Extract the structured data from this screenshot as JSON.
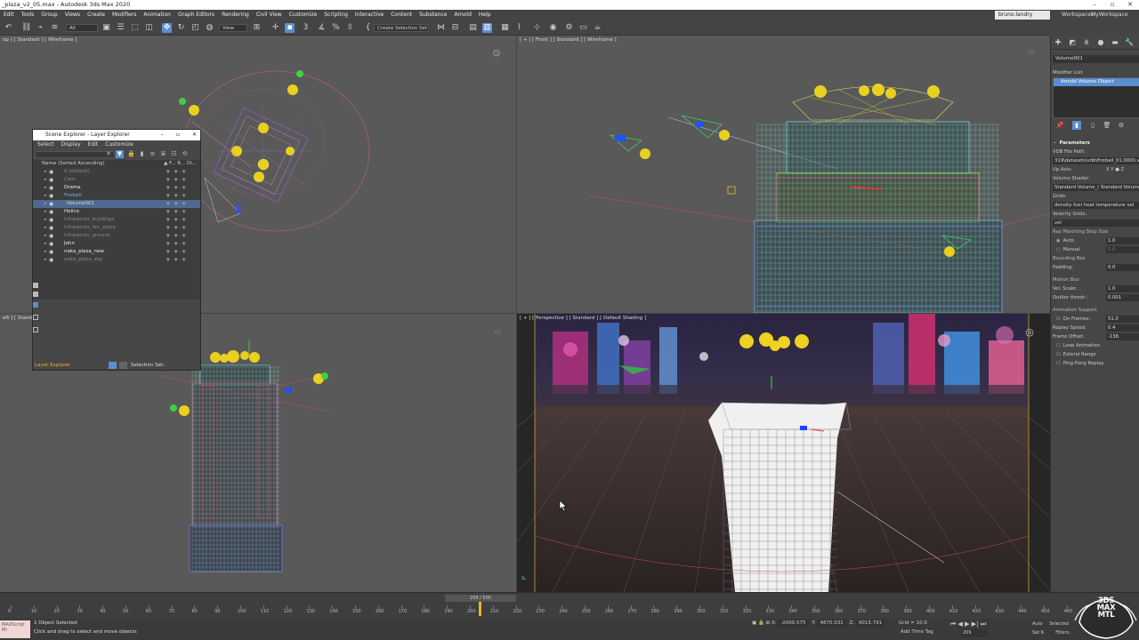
{
  "app": {
    "title": "_plaza_v2_05.max - Autodesk 3ds Max 2020"
  },
  "menubar": {
    "items": [
      "Edit",
      "Tools",
      "Group",
      "Views",
      "Create",
      "Modifiers",
      "Animation",
      "Graph Editors",
      "Rendering",
      "Civil View",
      "Customize",
      "Scripting",
      "Interactive",
      "Content",
      "Substance",
      "Arnold",
      "Help"
    ],
    "user": "bruno.landry",
    "workspaces_label": "Workspaces:",
    "workspace_value": "MyWorkspace"
  },
  "toolbar": {
    "filter_value": "All",
    "view_value": "View",
    "selection_set_placeholder": "Create Selection Set"
  },
  "viewports": {
    "top_left_label": "op ] [ Standard ] [ Wireframe ]",
    "top_right_label": "[ + ] [ Front ] [ Standard ] [ Wireframe ]",
    "bottom_left_label": "eft ] [ Standa",
    "bottom_right_label": "[ + ] [ Perspective ] [ Standard ] [ Default Shading ]"
  },
  "scene_explorer": {
    "title": "Scene Explorer - Layer Explorer",
    "menu": [
      "Select",
      "Display",
      "Edit",
      "Customize"
    ],
    "header": "Name (Sorted Ascending)",
    "header_cols": "▲ F...  R...  Di...",
    "rows": [
      {
        "name": "0 (default)",
        "style": "dim",
        "indent": 70
      },
      {
        "name": "Cam",
        "style": "dim",
        "indent": 70
      },
      {
        "name": "Drama",
        "style": "bright",
        "indent": 70
      },
      {
        "name": "Fireball",
        "style": "hl",
        "indent": 70
      },
      {
        "name": "Volume001",
        "style": "sel",
        "indent": 76
      },
      {
        "name": "Helico",
        "style": "bright",
        "indent": 70
      },
      {
        "name": "infraworks_buildings",
        "style": "dim",
        "indent": 70
      },
      {
        "name": "infraworks_fen_plaza",
        "style": "dim",
        "indent": 70
      },
      {
        "name": "infraworks_ground",
        "style": "dim",
        "indent": 70
      },
      {
        "name": "John",
        "style": "bright",
        "indent": 70
      },
      {
        "name": "naka_plaza_new",
        "style": "bright",
        "indent": 70
      },
      {
        "name": "naka_plaza_skp",
        "style": "dim",
        "indent": 70
      }
    ],
    "footer_label": "Layer Explorer",
    "selection_set_label": "Selection Set:"
  },
  "command_panel": {
    "object_name": "Volume001",
    "modifier_list_label": "Modifier List",
    "stack_item": "Arnold Volume Object",
    "params": {
      "title": "Parameters",
      "vdb_label": "VDB File Path:",
      "vdb_value": "319\\datasets\\vdb\\fireball_01.0000.vdb",
      "up_axis_label": "Up Axis:",
      "up_axis_value": "X  Y  ● Z",
      "shader_label": "Volume Shader:",
      "shader_value": "Standard Volume_( Standard Volume )",
      "grids_label": "Grids:",
      "grids_value": "density fuel heat temperature vel",
      "velocity_label": "Velocity Grids:",
      "velocity_value": "vel",
      "ray_label": "Ray Marching Step Size",
      "auto_label": "Auto",
      "auto_value": "1.0",
      "manual_label": "Manual",
      "manual_value": "1.0",
      "bbox_label": "Bounding Box",
      "padding_label": "Padding:",
      "padding_value": "0.0",
      "blur_label": "Motion Blur",
      "vel_scale_label": "Vel. Scale:",
      "vel_scale_value": "1.0",
      "outlier_label": "Outlier thresh.:",
      "outlier_value": "0.001",
      "anim_label": "Animation Support",
      "on_frames_label": "On Frames:",
      "on_frames_value": "51.0",
      "replay_label": "Replay Speed:",
      "replay_value": "0.4",
      "offset_label": "Frame Offset:",
      "offset_value": "-138",
      "loop_label": "Loop Animation",
      "extend_label": "Extend Range",
      "pingpong_label": "Ping-Pong Replay"
    }
  },
  "timeline": {
    "frame_display": "209 / 500",
    "ticks": [
      "0",
      "10",
      "20",
      "30",
      "40",
      "50",
      "60",
      "70",
      "80",
      "90",
      "100",
      "110",
      "120",
      "130",
      "140",
      "150",
      "160",
      "170",
      "180",
      "190",
      "200",
      "210",
      "220",
      "230",
      "240",
      "250",
      "260",
      "270",
      "280",
      "290",
      "300",
      "310",
      "320",
      "330",
      "340",
      "350",
      "360",
      "370",
      "380",
      "390",
      "400",
      "410",
      "420",
      "430",
      "440",
      "450",
      "460"
    ]
  },
  "status": {
    "script_label": "MAXScript Mi",
    "objects_selected": "1 Object Selected",
    "prompt": "Click and drag to select and move objects",
    "x_label": "X:",
    "x_value": "-2000.575",
    "y_label": "Y:",
    "y_value": "4870.031",
    "z_label": "Z:",
    "z_value": "9015.791",
    "grid": "Grid = 10.0",
    "add_time_tag": "Add Time Tag",
    "current_frame": "209",
    "auto_key": "Auto",
    "selected_label": "Selected",
    "set_key": "Set K.",
    "filters": "Filters..."
  },
  "logo": {
    "line1": "3DS",
    "line2": "MAX",
    "line3": "MTL"
  },
  "colors": {
    "accent": "#5a8fd0",
    "viewport_bg": "#595959",
    "highlight_orange": "#f0b030"
  }
}
